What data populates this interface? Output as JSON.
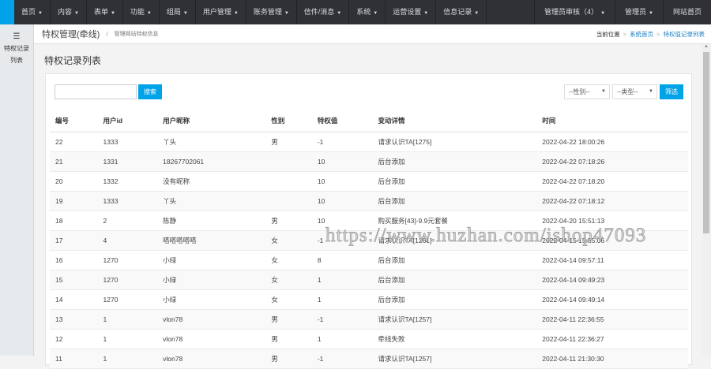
{
  "topnav": {
    "items": [
      "首页",
      "内容",
      "表单",
      "功能",
      "组局",
      "用户管理",
      "账务管理",
      "信件/消息",
      "系统",
      "运营设置",
      "信息记录"
    ],
    "right": [
      {
        "label": "管理员审核（4）",
        "caret": true
      },
      {
        "label": "管理员",
        "caret": true
      },
      {
        "label": "网站首页",
        "caret": false
      }
    ]
  },
  "sidebar": {
    "icon": "list-icon",
    "label": "特权记录列表"
  },
  "breadcrumb": {
    "title": "特权管理(牵线)",
    "subtitle": "管理网站特权信息",
    "pos_label": "当前位置",
    "links": [
      "系统首页",
      "特权值记录列表"
    ]
  },
  "page_title": "特权记录列表",
  "filters": {
    "search_button": "搜索",
    "gender": "--性别--",
    "type": "--类型--",
    "filter_button": "筛选"
  },
  "table": {
    "headers": [
      "编号",
      "用户id",
      "用户昵称",
      "性别",
      "特权值",
      "变动详情",
      "时间"
    ],
    "rows": [
      [
        "22",
        "1333",
        "丫头",
        "男",
        "-1",
        "请求认识TA[1275]",
        "2022-04-22 18:00:26"
      ],
      [
        "21",
        "1331",
        "18267702061",
        "",
        "10",
        "后台添加",
        "2022-04-22 07:18:26"
      ],
      [
        "20",
        "1332",
        "没有昵称",
        "",
        "10",
        "后台添加",
        "2022-04-22 07:18:20"
      ],
      [
        "19",
        "1333",
        "丫头",
        "",
        "10",
        "后台添加",
        "2022-04-22 07:18:12"
      ],
      [
        "18",
        "2",
        "陈静",
        "男",
        "10",
        "购买服务[43]-9.9元套餐",
        "2022-04-20 15:51:13"
      ],
      [
        "17",
        "4",
        "嗒嗒嗒嗒嗒",
        "女",
        "-1",
        "请求认识TA[1261]",
        "2022-04-15 15:55:06"
      ],
      [
        "16",
        "1270",
        "小绿",
        "女",
        "8",
        "后台添加",
        "2022-04-14 09:57:11"
      ],
      [
        "15",
        "1270",
        "小绿",
        "女",
        "1",
        "后台添加",
        "2022-04-14 09:49:23"
      ],
      [
        "14",
        "1270",
        "小绿",
        "女",
        "1",
        "后台添加",
        "2022-04-14 09:49:14"
      ],
      [
        "13",
        "1",
        "vlon78",
        "男",
        "-1",
        "请求认识TA[1257]",
        "2022-04-11 22:36:55"
      ],
      [
        "12",
        "1",
        "vlon78",
        "男",
        "1",
        "牵线失败",
        "2022-04-11 22:36:27"
      ],
      [
        "11",
        "1",
        "vlon78",
        "男",
        "-1",
        "请求认识TA[1257]",
        "2022-04-11 21:30:30"
      ]
    ]
  },
  "watermark": "https://www.huzhan.com/ishop47093"
}
